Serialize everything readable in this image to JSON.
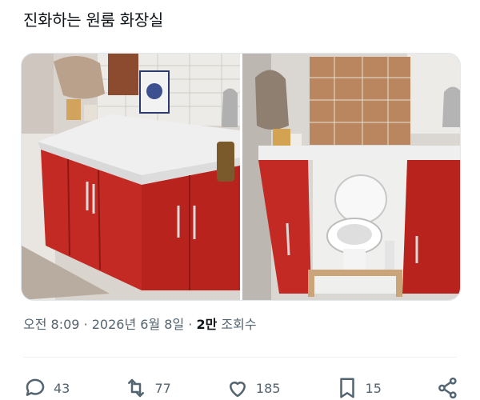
{
  "tweet": {
    "text": "진화하는 원룸 화장실",
    "images": [
      {
        "subject": "red-kitchen-cabinets"
      },
      {
        "subject": "toilet-inside-kitchen-cabinet"
      }
    ]
  },
  "meta": {
    "time": "오전 8:09",
    "separator1": "·",
    "date": "2026년 6월 8일",
    "separator2": "·",
    "views_count": "2만",
    "views_label": "조회수"
  },
  "actions": {
    "replies": "43",
    "retweets": "77",
    "likes": "185",
    "bookmarks": "15"
  }
}
